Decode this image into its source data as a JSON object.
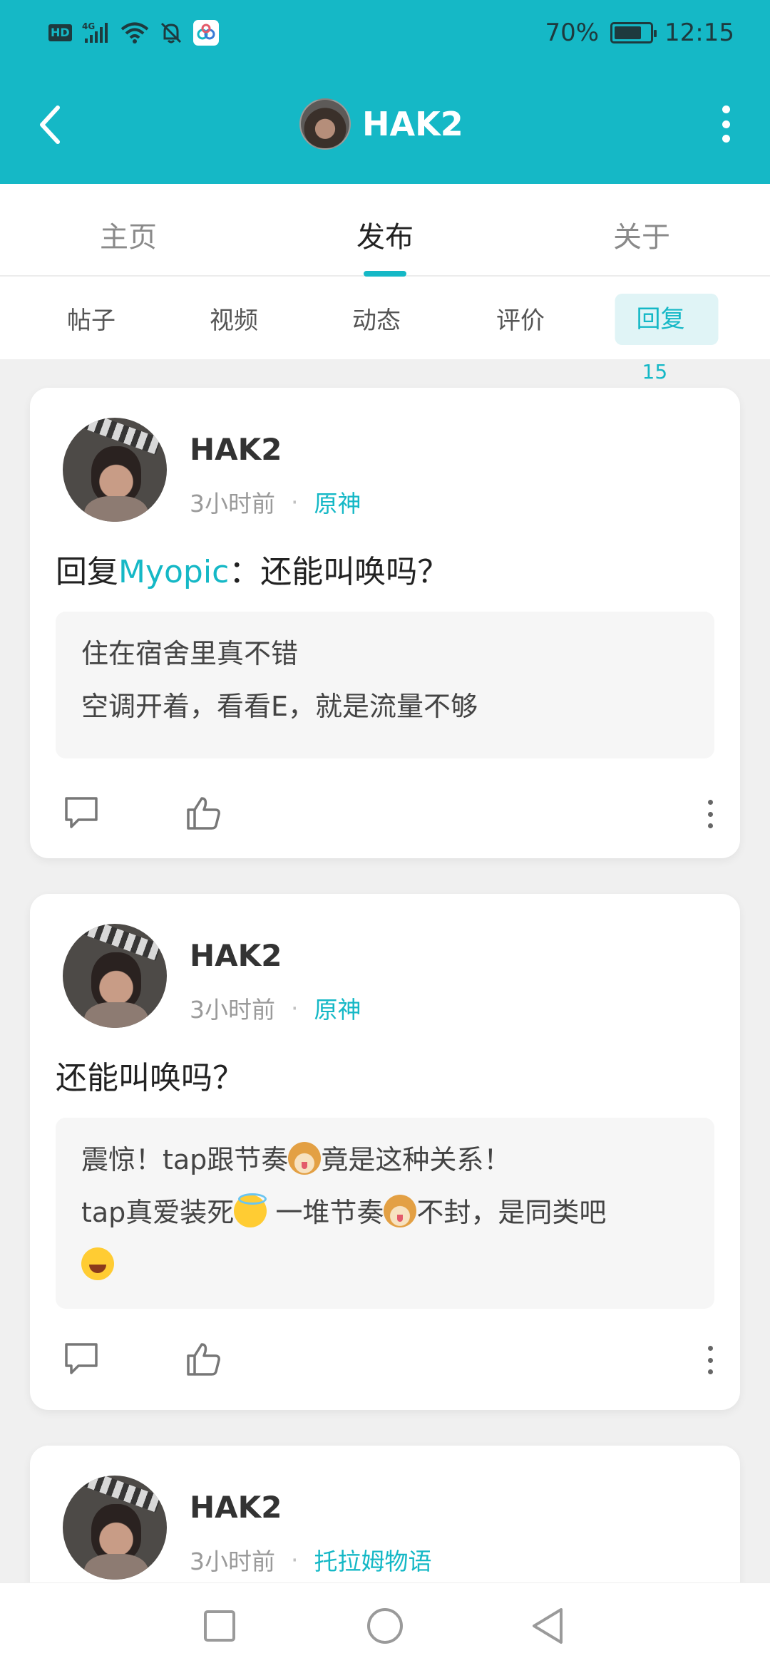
{
  "status_bar": {
    "hd_label": "HD",
    "network": "4G",
    "battery": "70%",
    "time": "12:15"
  },
  "header": {
    "title": "HAK2"
  },
  "main_tabs": [
    {
      "label": "主页"
    },
    {
      "label": "发布"
    },
    {
      "label": "关于"
    }
  ],
  "sub_tabs": [
    {
      "label": "帖子"
    },
    {
      "label": "视频"
    },
    {
      "label": "动态"
    },
    {
      "label": "评价"
    },
    {
      "label": "回复",
      "count": "15"
    }
  ],
  "posts": [
    {
      "author": "HAK2",
      "time": "3小时前",
      "separator": "·",
      "game": "原神",
      "reply_prefix": "回复",
      "reply_to": "Myopic",
      "reply_sep": "：",
      "reply_text": "还能叫唤吗？",
      "quote_line1": "住在宿舍里真不错",
      "quote_line2": "空调开着，看看E，就是流量不够"
    },
    {
      "author": "HAK2",
      "time": "3小时前",
      "separator": "·",
      "game": "原神",
      "reply_text": "还能叫唤吗？",
      "quote_l1_a": "震惊！tap跟节奏",
      "quote_l1_b": "竟是这种关系！",
      "quote_l2_a": "tap真爱装死",
      "quote_l2_b": " 一堆节奏",
      "quote_l2_c": "不封，是同类吧"
    },
    {
      "author": "HAK2",
      "time": "3小时前",
      "separator": "·",
      "game": "托拉姆物语"
    }
  ],
  "colors": {
    "accent": "#15b8c6",
    "background": "#f0f0f0"
  }
}
